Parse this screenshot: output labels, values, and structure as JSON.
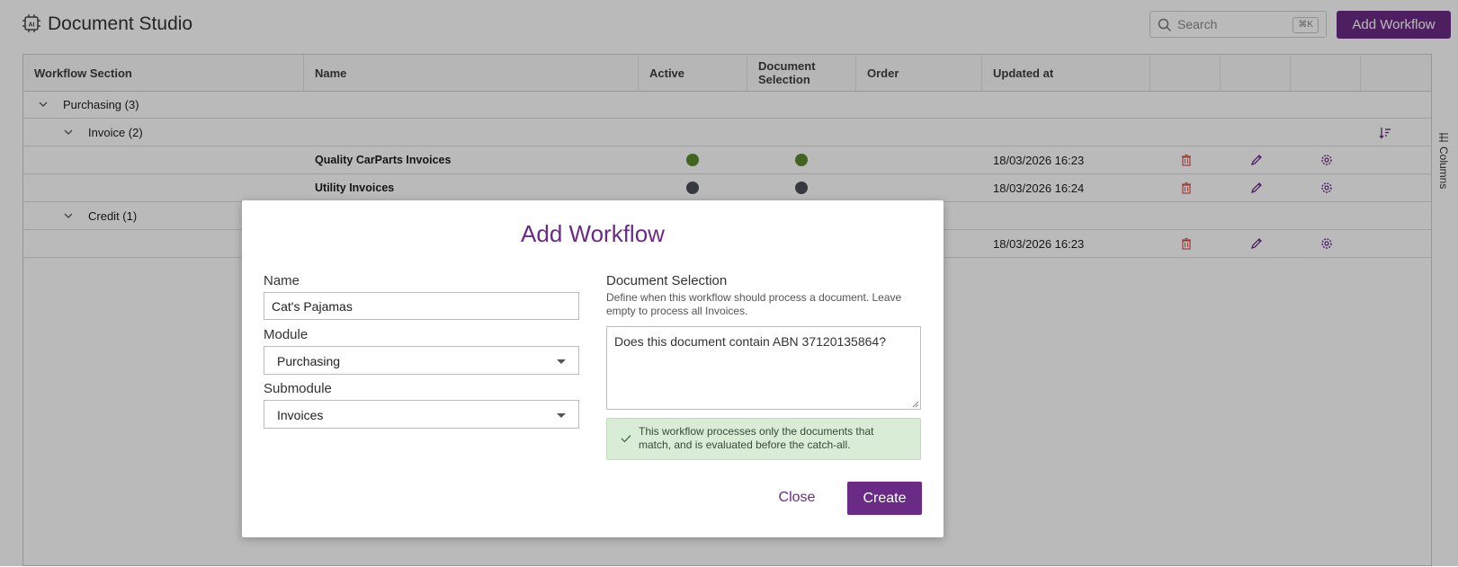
{
  "app": {
    "title": "Document Studio",
    "logo_icon": "ai-chip-icon"
  },
  "search": {
    "placeholder": "Search",
    "shortcut": "⌘K"
  },
  "header": {
    "add_workflow_label": "Add Workflow"
  },
  "grid": {
    "columns": [
      "Workflow Section",
      "Name",
      "Active",
      "Document Selection",
      "Order",
      "Updated at",
      "",
      "",
      "",
      ""
    ],
    "side_tab_label": "Columns",
    "groups": [
      {
        "label": "Purchasing (3)",
        "level": 1
      },
      {
        "label": "Invoice (2)",
        "level": 2
      },
      {
        "label": "Credit (1)",
        "level": 2
      }
    ],
    "rows": [
      {
        "name": "Quality CarParts Invoices",
        "active": true,
        "doc_selection": true,
        "updated_at": "18/03/2026 16:23"
      },
      {
        "name": "Utility Invoices",
        "active": false,
        "doc_selection": false,
        "updated_at": "18/03/2026 16:24"
      },
      {
        "name": "",
        "updated_at": "18/03/2026 16:23"
      }
    ],
    "colors": {
      "active_on": "#5a8a2e",
      "active_off": "#4b4f57",
      "delete": "#d9534f",
      "edit": "#6a2b86",
      "settings": "#6a2b86"
    }
  },
  "modal": {
    "title": "Add Workflow",
    "name_label": "Name",
    "name_value": "Cat's Pajamas",
    "module_label": "Module",
    "module_value": "Purchasing",
    "submodule_label": "Submodule",
    "submodule_value": "Invoices",
    "doc_selection_label": "Document Selection",
    "doc_selection_help": "Define when this workflow should process a document. Leave empty to process all Invoices.",
    "doc_selection_value": "Does this document contain ABN 37120135864?",
    "alert_text": "This workflow processes only the documents that match, and is evaluated before the catch-all.",
    "close_label": "Close",
    "create_label": "Create"
  },
  "theme": {
    "brand": "#6a2b86",
    "success_bg": "#d8ecd6"
  }
}
